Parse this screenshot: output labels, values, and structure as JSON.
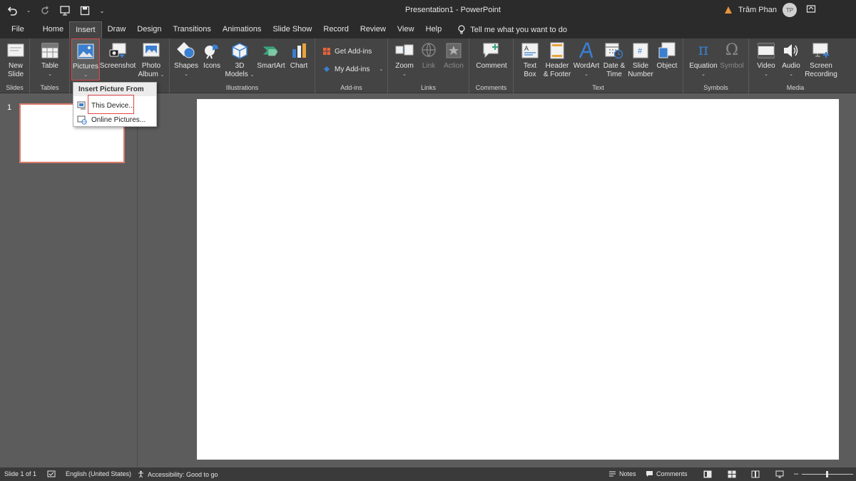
{
  "app": {
    "title": "Presentation1  -  PowerPoint",
    "user_name": "Trâm Phan",
    "user_initials": "TP"
  },
  "tabs": [
    {
      "label": "File"
    },
    {
      "label": "Home"
    },
    {
      "label": "Insert",
      "active": true
    },
    {
      "label": "Draw"
    },
    {
      "label": "Design"
    },
    {
      "label": "Transitions"
    },
    {
      "label": "Animations"
    },
    {
      "label": "Slide Show"
    },
    {
      "label": "Record"
    },
    {
      "label": "Review"
    },
    {
      "label": "View"
    },
    {
      "label": "Help"
    }
  ],
  "tell_me": "Tell me what you want to do",
  "ribbon": {
    "slides": {
      "label": "Slides",
      "new_slide_1": "New",
      "new_slide_2": "Slide"
    },
    "tables": {
      "label": "Tables",
      "table": "Table"
    },
    "images": {
      "pictures": "Pictures",
      "screenshot": "Screenshot",
      "photo_album_1": "Photo",
      "photo_album_2": "Album"
    },
    "illustrations": {
      "label": "Illustrations",
      "shapes": "Shapes",
      "icons": "Icons",
      "models_1": "3D",
      "models_2": "Models",
      "smartart": "SmartArt",
      "chart": "Chart"
    },
    "addins": {
      "label": "Add-ins",
      "get": "Get Add-ins",
      "my": "My Add-ins"
    },
    "links": {
      "label": "Links",
      "zoom": "Zoom",
      "link": "Link",
      "action": "Action"
    },
    "comments": {
      "label": "Comments",
      "comment": "Comment"
    },
    "text": {
      "label": "Text",
      "textbox_1": "Text",
      "textbox_2": "Box",
      "header_1": "Header",
      "header_2": "& Footer",
      "wordart": "WordArt",
      "datetime_1": "Date &",
      "datetime_2": "Time",
      "slidenum_1": "Slide",
      "slidenum_2": "Number",
      "object": "Object"
    },
    "symbols": {
      "label": "Symbols",
      "equation": "Equation",
      "symbol": "Symbol"
    },
    "media": {
      "label": "Media",
      "video": "Video",
      "audio": "Audio",
      "screenrec_1": "Screen",
      "screenrec_2": "Recording"
    }
  },
  "dropdown": {
    "header": "Insert Picture From",
    "items": [
      {
        "label": "This Device..."
      },
      {
        "label": "Online Pictures..."
      }
    ]
  },
  "slides": {
    "number": "1"
  },
  "status": {
    "slide_info": "Slide 1 of 1",
    "language": "English (United States)",
    "accessibility": "Accessibility: Good to go",
    "notes": "Notes",
    "comments": "Comments"
  },
  "colors": {
    "titlebar": "#2b2b2b",
    "ribbon": "#444444",
    "workspace": "#5c5c5c",
    "highlight": "#e04848"
  }
}
